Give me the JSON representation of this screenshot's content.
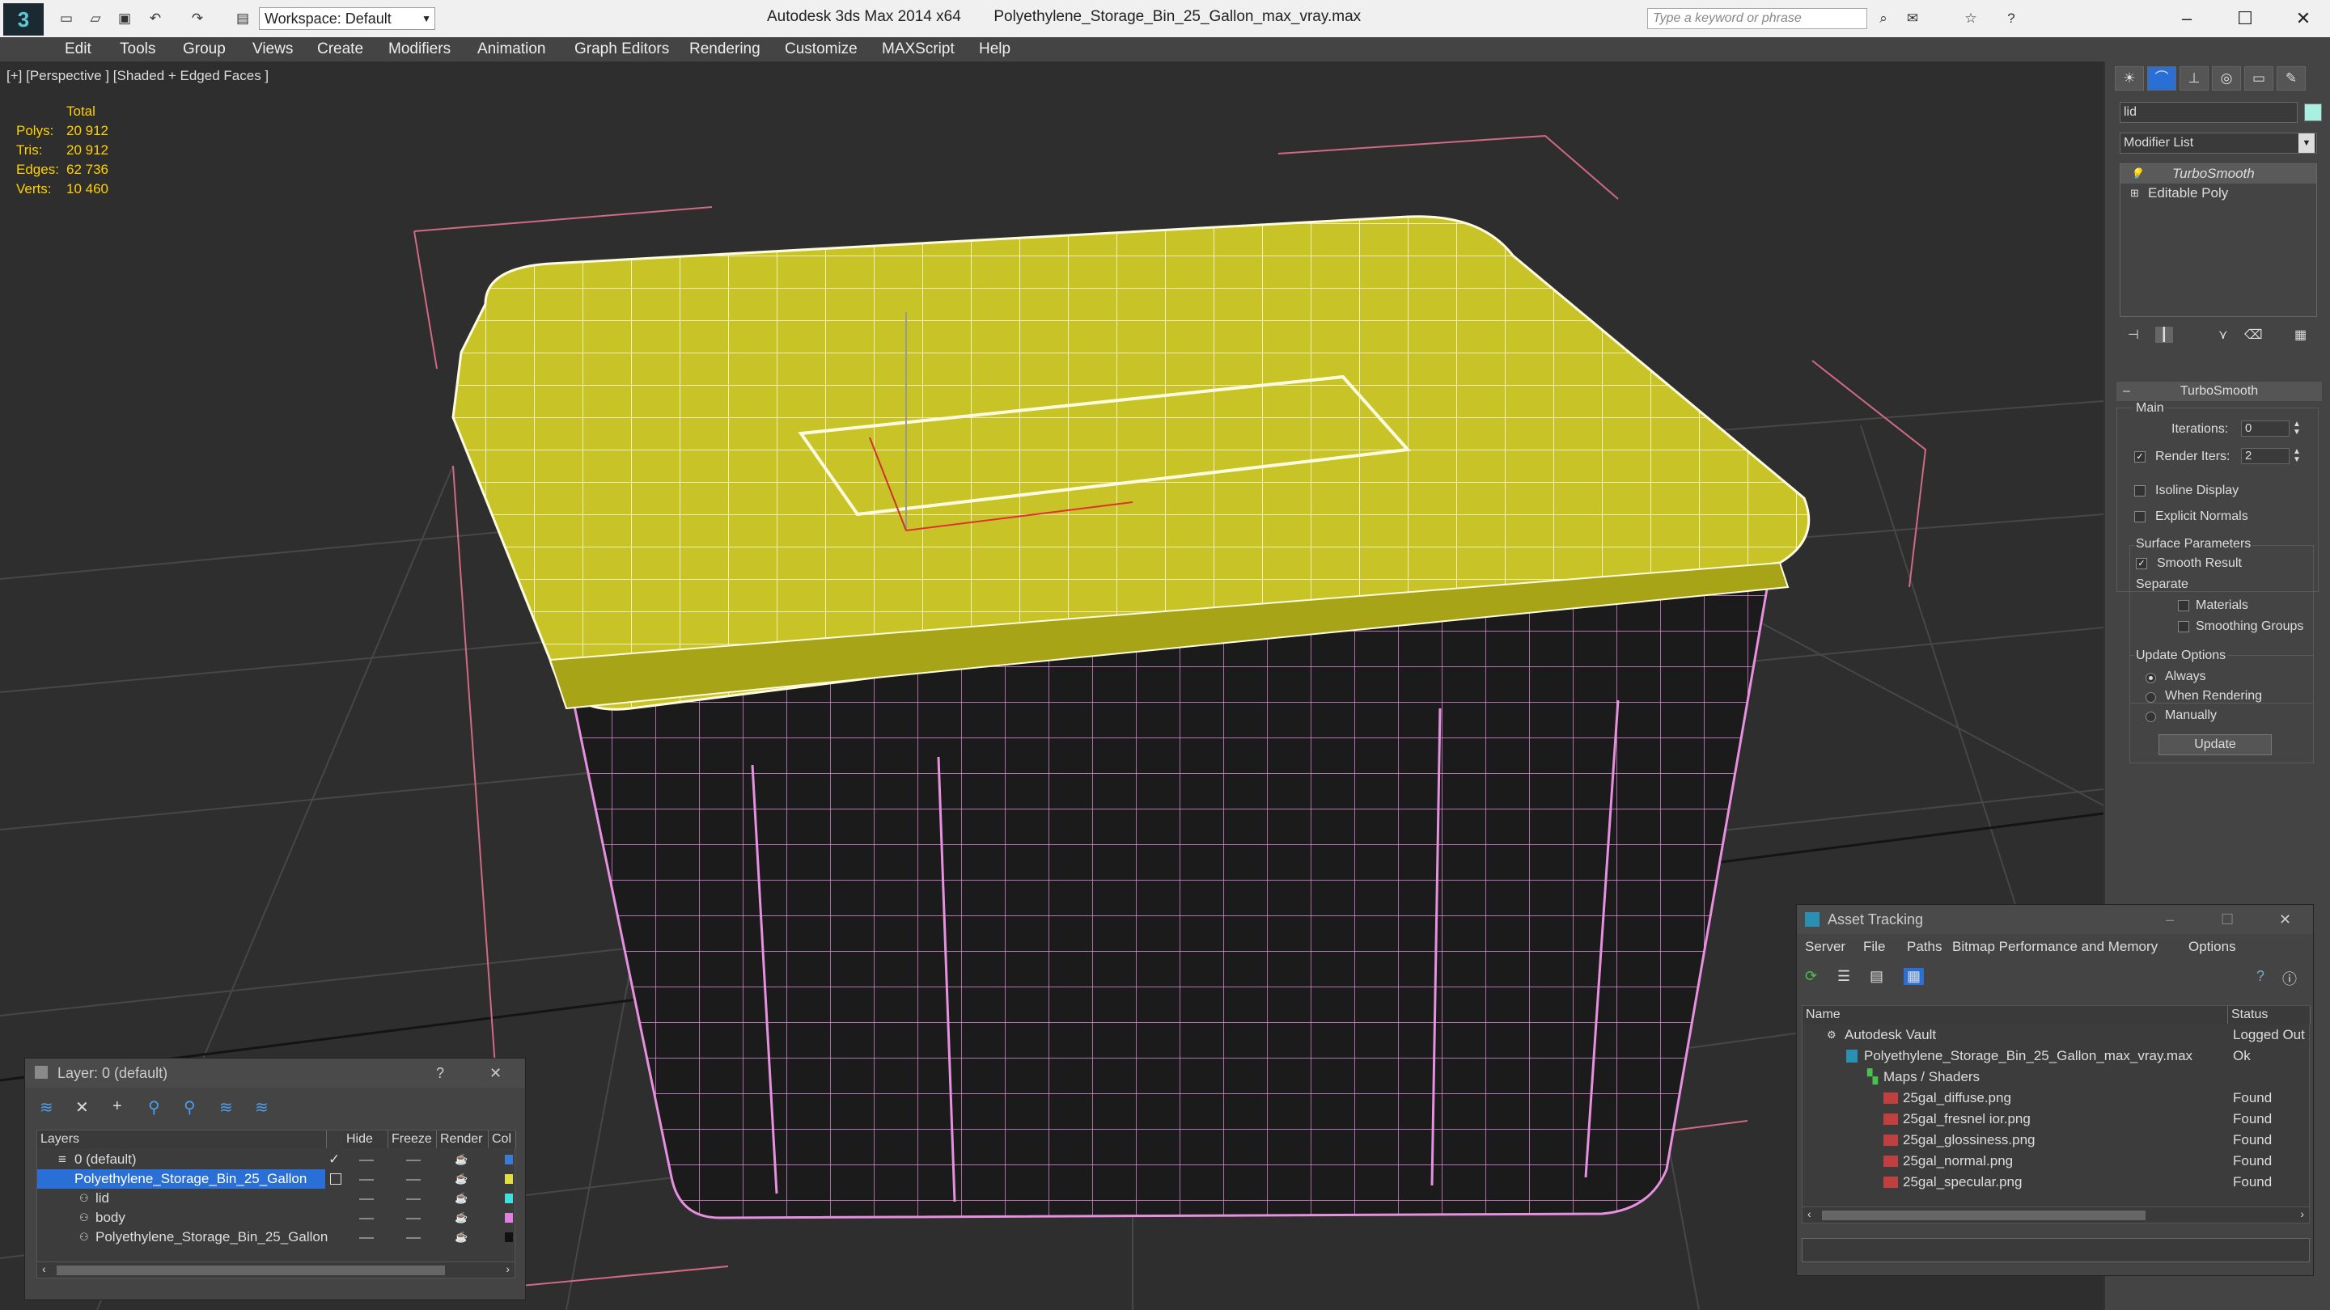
{
  "app_title": "Autodesk 3ds Max  2014 x64",
  "file_name": "Polyethylene_Storage_Bin_25_Gallon_max_vray.max",
  "workspace": "Workspace: Default",
  "search_placeholder": "Type a keyword or phrase",
  "menu": [
    "Edit",
    "Tools",
    "Group",
    "Views",
    "Create",
    "Modifiers",
    "Animation",
    "Graph Editors",
    "Rendering",
    "Customize",
    "MAXScript",
    "Help"
  ],
  "viewport": {
    "label": "[+] [Perspective ] [Shaded + Edged Faces ]",
    "stats": {
      "header": "Total",
      "rows": [
        {
          "label": "Polys:",
          "value": "20 912"
        },
        {
          "label": "Tris:",
          "value": "20 912"
        },
        {
          "label": "Edges:",
          "value": "62 736"
        },
        {
          "label": "Verts:",
          "value": "10 460"
        }
      ]
    }
  },
  "command_panel": {
    "object_name": "lid",
    "modifier_list": "Modifier List",
    "stack": [
      "TurboSmooth",
      "Editable Poly"
    ],
    "rollout_title": "TurboSmooth",
    "main_group": "Main",
    "iterations_label": "Iterations:",
    "iterations_value": "0",
    "render_iters_label": "Render Iters:",
    "render_iters_value": "2",
    "render_iters_checked": true,
    "isoline_label": "Isoline Display",
    "explicit_normals_label": "Explicit Normals",
    "surface_group": "Surface Parameters",
    "smooth_result_label": "Smooth Result",
    "separate_label": "Separate",
    "materials_label": "Materials",
    "smoothing_groups_label": "Smoothing Groups",
    "update_group": "Update Options",
    "always_label": "Always",
    "when_rendering_label": "When Rendering",
    "manually_label": "Manually",
    "update_button": "Update"
  },
  "layer_window": {
    "title": "Layer: 0 (default)",
    "help": "?",
    "columns": [
      "Layers",
      "Hide",
      "Freeze",
      "Render",
      "Col"
    ],
    "rows": [
      {
        "name": "0 (default)",
        "color": "#3a7bd5"
      },
      {
        "name": "Polyethylene_Storage_Bin_25_Gallon",
        "color": "#e0e040"
      },
      {
        "name": "lid",
        "color": "#40e0e0"
      },
      {
        "name": "body",
        "color": "#e080e0"
      },
      {
        "name": "Polyethylene_Storage_Bin_25_Gallon",
        "color": "#111111"
      }
    ]
  },
  "asset_window": {
    "title": "Asset Tracking",
    "menu": [
      "Server",
      "File",
      "Paths",
      "Bitmap Performance and Memory",
      "Options"
    ],
    "columns": [
      "Name",
      "Status"
    ],
    "rows": [
      {
        "name": "Autodesk Vault",
        "status": "Logged Out"
      },
      {
        "name": "Polyethylene_Storage_Bin_25_Gallon_max_vray.max",
        "status": "Ok"
      },
      {
        "name": "Maps / Shaders",
        "status": ""
      },
      {
        "name": "25gal_diffuse.png",
        "status": "Found"
      },
      {
        "name": "25gal_fresnel ior.png",
        "status": "Found"
      },
      {
        "name": "25gal_glossiness.png",
        "status": "Found"
      },
      {
        "name": "25gal_normal.png",
        "status": "Found"
      },
      {
        "name": "25gal_specular.png",
        "status": "Found"
      }
    ]
  },
  "colors": {
    "lid": "#c8c428",
    "wire_body": "#e890e0",
    "accent": "#2a6fd6",
    "stats": "#ffd000"
  }
}
